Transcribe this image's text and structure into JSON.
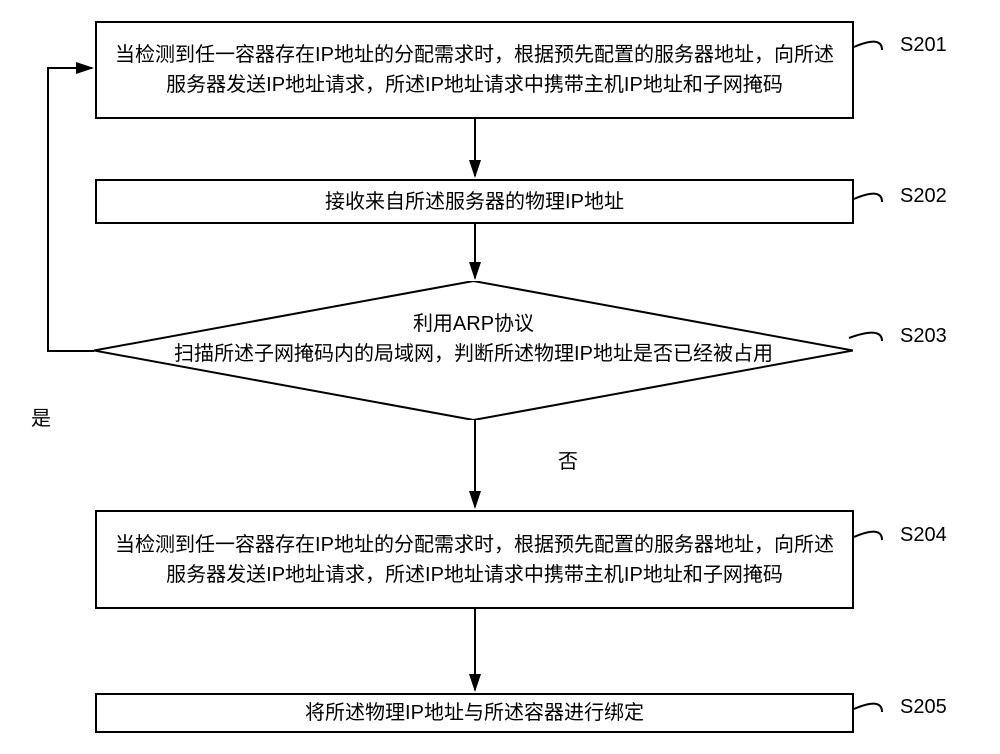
{
  "step1": {
    "text": "当检测到任一容器存在IP地址的分配需求时，根据预先配置的服务器地址，向所述服务器发送IP地址请求，所述IP地址请求中携带主机IP地址和子网掩码",
    "label": "S201"
  },
  "step2": {
    "text": "接收来自所述服务器的物理IP地址",
    "label": "S202"
  },
  "step3": {
    "line1": "利用ARP协议",
    "line2": "扫描所述子网掩码内的局域网，判断所述物理IP地址是否已经被占用",
    "label": "S203"
  },
  "step4": {
    "text": "当检测到任一容器存在IP地址的分配需求时，根据预先配置的服务器地址，向所述服务器发送IP地址请求，所述IP地址请求中携带主机IP地址和子网掩码",
    "label": "S204"
  },
  "step5": {
    "text": "将所述物理IP地址与所述容器进行绑定",
    "label": "S205"
  },
  "edge_yes": "是",
  "edge_no": "否"
}
